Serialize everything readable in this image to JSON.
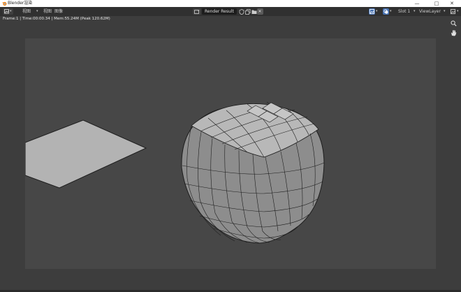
{
  "window": {
    "title": "Blender渲染",
    "controls": {
      "minimize": "—",
      "maximize": "□",
      "close": "✕"
    }
  },
  "header": {
    "menu": [
      "视图",
      "图像"
    ],
    "image_name": "Render Result",
    "slot": "Slot 1",
    "view_layer": "ViewLayer"
  },
  "status": {
    "frame_info": "Frame:1 | Time:00:00.34 | Mem:55.24M (Peak 120.62M)"
  },
  "colors": {
    "accent": "#4772b3",
    "background": "#3d3d3d",
    "render_bg": "#474747"
  },
  "icons": [
    "blender-icon",
    "editor-type-icon",
    "chevron-down-icon",
    "image-browse-icon",
    "shield-icon",
    "duplicate-icon",
    "folder-icon",
    "close-icon",
    "display-channels-icon",
    "overlay-icon",
    "zoom-icon",
    "hand-icon"
  ]
}
